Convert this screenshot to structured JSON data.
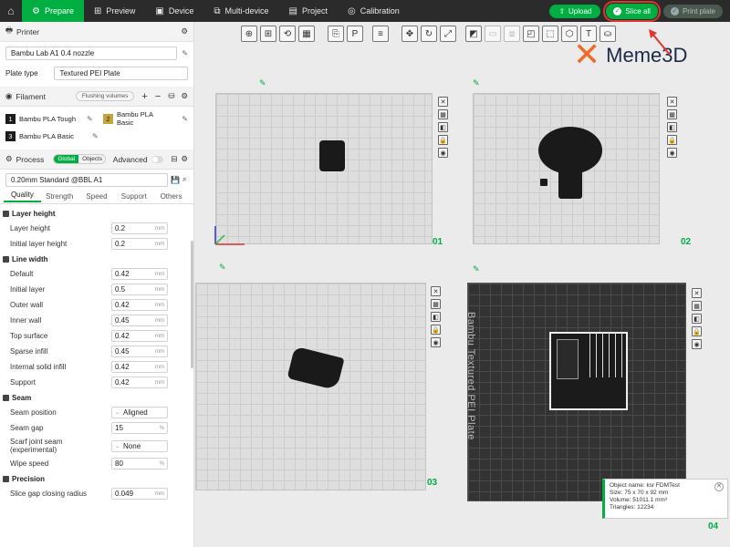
{
  "topbar": {
    "tabs": [
      {
        "label": "Prepare",
        "active": true
      },
      {
        "label": "Preview"
      },
      {
        "label": "Device"
      },
      {
        "label": "Multi-device"
      },
      {
        "label": "Project"
      },
      {
        "label": "Calibration"
      }
    ],
    "upload_label": "Upload",
    "slice_label": "Slice all",
    "print_label": "Print plate"
  },
  "printer": {
    "header": "Printer",
    "name": "Bambu Lab A1 0.4 nozzle",
    "plate_type_label": "Plate type",
    "plate_type": "Textured PEI Plate"
  },
  "filament": {
    "header": "Filament",
    "flush_label": "Flushing volumes",
    "items": [
      {
        "num": "1",
        "name": "Bambu PLA Tough",
        "color": "#1c1c1c"
      },
      {
        "num": "2",
        "name": "Bambu PLA Basic",
        "color": "#c7a33b"
      },
      {
        "num": "3",
        "name": "Bambu PLA Basic",
        "color": "#1c1c1c"
      }
    ]
  },
  "process": {
    "header": "Process",
    "global_label": "Global",
    "objects_label": "Objects",
    "advanced_label": "Advanced",
    "preset": "0.20mm Standard @BBL A1",
    "tabs": [
      "Quality",
      "Strength",
      "Speed",
      "Support",
      "Others"
    ]
  },
  "groups": {
    "layer_height": {
      "title": "Layer height",
      "params": [
        {
          "label": "Layer height",
          "value": "0.2",
          "unit": "mm"
        },
        {
          "label": "Initial layer height",
          "value": "0.2",
          "unit": "mm"
        }
      ]
    },
    "line_width": {
      "title": "Line width",
      "params": [
        {
          "label": "Default",
          "value": "0.42",
          "unit": "mm"
        },
        {
          "label": "Initial layer",
          "value": "0.5",
          "unit": "mm"
        },
        {
          "label": "Outer wall",
          "value": "0.42",
          "unit": "mm"
        },
        {
          "label": "Inner wall",
          "value": "0.45",
          "unit": "mm"
        },
        {
          "label": "Top surface",
          "value": "0.42",
          "unit": "mm"
        },
        {
          "label": "Sparse infill",
          "value": "0.45",
          "unit": "mm"
        },
        {
          "label": "Internal solid infill",
          "value": "0.42",
          "unit": "mm"
        },
        {
          "label": "Support",
          "value": "0.42",
          "unit": "mm"
        }
      ]
    },
    "seam": {
      "title": "Seam",
      "seam_position_label": "Seam position",
      "seam_position": "Aligned",
      "seam_gap_label": "Seam gap",
      "seam_gap": "15",
      "seam_gap_unit": "%",
      "scarf_label_1": "Scarf joint seam",
      "scarf_label_2": "(experimental)",
      "scarf_value": "None",
      "wipe_label": "Wipe speed",
      "wipe_value": "80",
      "wipe_unit": "%"
    },
    "precision": {
      "title": "Precision",
      "label": "Slice gap closing radius",
      "value": "0.049",
      "unit": "mm"
    }
  },
  "plates": [
    {
      "num": "01"
    },
    {
      "num": "02"
    },
    {
      "num": "03"
    },
    {
      "num": "04",
      "label": "Bambu Textured PEI Plate"
    }
  ],
  "watermark": {
    "text": "Meme3D",
    "accent": "#ee6b2a"
  },
  "object_info": {
    "name": "Object name: ksr FDMTest",
    "size": "Size: 75 x 70 x 92 mm",
    "volume": "Volume: 51011.1 mm³",
    "triangles": "Triangles: 12234"
  },
  "colors": {
    "accent": "#00ae42",
    "highlight": "#e0342a"
  }
}
